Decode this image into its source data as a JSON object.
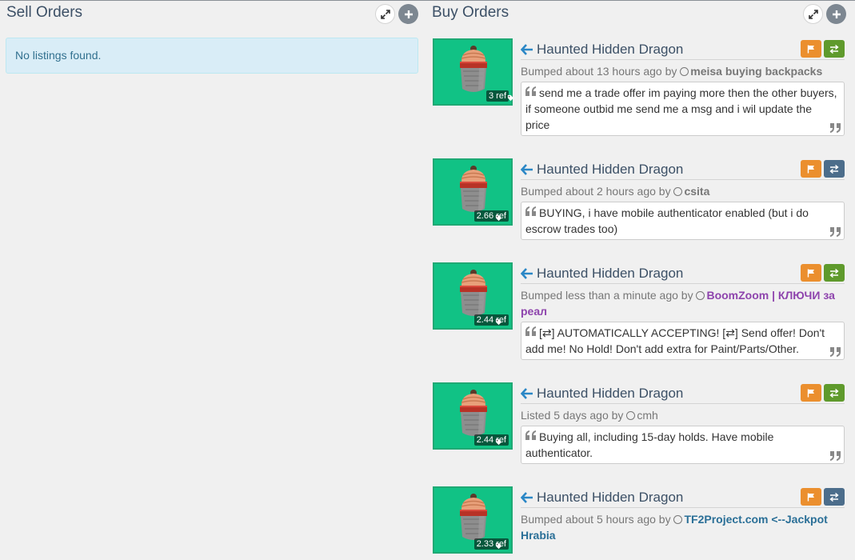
{
  "sell": {
    "title": "Sell Orders",
    "empty_text": "No listings found."
  },
  "buy": {
    "title": "Buy Orders",
    "listings": [
      {
        "item": "Haunted Hidden Dragon",
        "price": "3 ref",
        "status": "Bumped about 13 hours ago by",
        "user": "meisa buying backpacks",
        "user_style": "bold",
        "trade_color": "green",
        "comment": "send me a trade offer im paying more then the other buyers, if someone outbid me send me a msg and i wil update the price"
      },
      {
        "item": "Haunted Hidden Dragon",
        "price": "2.66 ref",
        "status": "Bumped about 2 hours ago by",
        "user": "csita",
        "user_style": "bold",
        "trade_color": "blue",
        "comment": "BUYING, i have mobile authenticator enabled (but i do escrow trades too)"
      },
      {
        "item": "Haunted Hidden Dragon",
        "price": "2.44 ref",
        "status": "Bumped less than a minute ago by",
        "user": "BoomZoom | КЛЮЧИ за реал",
        "user_style": "purple",
        "trade_color": "green",
        "comment": "[⇄] AUTOMATICALLY ACCEPTING! [⇄] Send offer! Don't add me! No Hold! Don't add extra for Paint/Parts/Other."
      },
      {
        "item": "Haunted Hidden Dragon",
        "price": "2.44 ref",
        "status": "Listed 5 days ago by",
        "user": "cmh",
        "user_style": "plain",
        "trade_color": "green",
        "comment": "Buying all, including 15-day holds. Have mobile authenticator."
      },
      {
        "item": "Haunted Hidden Dragon",
        "price": "2.33 ref",
        "status": "Bumped about 5 hours ago by",
        "user": "TF2Project.com <--Jackpot Hrabia",
        "user_style": "blue",
        "trade_color": "blue",
        "comment": ""
      }
    ]
  },
  "colors": {
    "item_bg": "#11c285",
    "flag": "#eb8f2e",
    "trade_green": "#5f9a2c",
    "trade_blue": "#4c6d8b",
    "alert_bg": "#d9edf7",
    "alert_text": "#31708f"
  },
  "icons": {
    "expand": "expand-icon",
    "add": "plus-icon",
    "price": "tag-icon",
    "link": "arrow-left-icon",
    "flag": "flag-icon",
    "trade": "exchange-icon",
    "user": "user-circle-icon",
    "quote_open": "quote-left-icon",
    "quote_close": "quote-right-icon"
  }
}
